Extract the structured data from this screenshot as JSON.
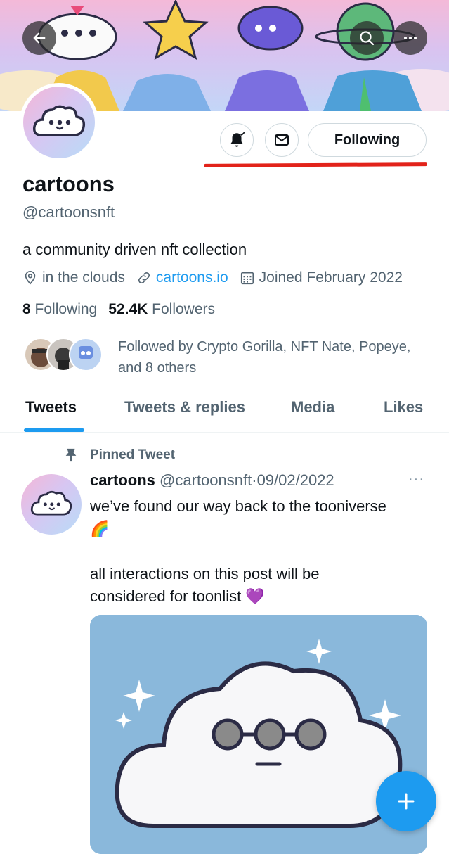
{
  "header": {
    "back_icon": "arrow-left-icon",
    "search_icon": "search-icon",
    "more_icon": "more-horizontal-icon"
  },
  "profile": {
    "name": "cartoons",
    "handle": "@cartoonsnft",
    "bio": "a community driven nft collection",
    "location": "in the clouds",
    "website": "cartoons.io",
    "joined": "Joined February 2022",
    "following_count": "8",
    "following_label": "Following",
    "followers_count": "52.4K",
    "followers_label": "Followers",
    "followed_by_text": "Followed by Crypto Gorilla, NFT Nate, Popeye, and 8 others"
  },
  "actions": {
    "notify_icon": "bell-check-icon",
    "message_icon": "envelope-icon",
    "following_label": "Following"
  },
  "tabs": [
    {
      "label": "Tweets",
      "active": true
    },
    {
      "label": "Tweets & replies",
      "active": false
    },
    {
      "label": "Media",
      "active": false
    },
    {
      "label": "Likes",
      "active": false
    }
  ],
  "tweet": {
    "pinned_label": "Pinned Tweet",
    "author": "cartoons",
    "handle": "@cartoonsnft",
    "dot": "·",
    "date": "09/02/2022",
    "more": "···",
    "line1": "we’ve found our way back to the tooniverse",
    "emoji1": "🌈",
    "line2": "all interactions on this post will be considered for toonlist",
    "emoji2": "💜"
  },
  "colors": {
    "accent": "#1d9bf0",
    "text": "#0f1419",
    "secondary": "#536471",
    "annotation_red": "#e2231a"
  },
  "fab": {
    "icon": "plus-icon"
  }
}
